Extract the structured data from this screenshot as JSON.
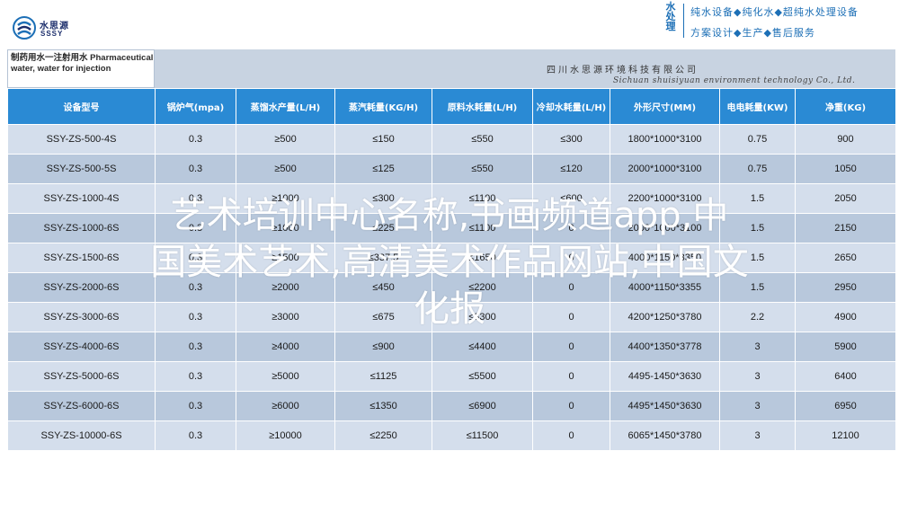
{
  "header": {
    "logo_cn": "水思源",
    "logo_en": "SSSY",
    "vertical_text": "水处理",
    "line1": "纯水设备◆纯化水◆超纯水处理设备",
    "line2": "方案设计◆生产◆售后服务"
  },
  "document": {
    "title": "制药用水一注射用水 Pharmaceutical water, water for injection",
    "company_cn": "四川水思源环境科技有限公司",
    "company_en": "Sichuan shuisiyuan environment technology Co., Ltd."
  },
  "table": {
    "headers": [
      "设备型号",
      "锅炉气(mpa)",
      "蒸馏水产量(L/H)",
      "蒸汽耗量(KG/H)",
      "原料水耗量(L/H)",
      "冷却水耗量(L/H)",
      "外形尺寸(MM)",
      "电电耗量(KW)",
      "净重(KG)"
    ],
    "rows": [
      [
        "SSY-ZS-500-4S",
        "0.3",
        "≥500",
        "≤150",
        "≤550",
        "≤300",
        "1800*1000*3100",
        "0.75",
        "900"
      ],
      [
        "SSY-ZS-500-5S",
        "0.3",
        "≥500",
        "≤125",
        "≤550",
        "≤120",
        "2000*1000*3100",
        "0.75",
        "1050"
      ],
      [
        "SSY-ZS-1000-4S",
        "0.3",
        "≥1000",
        "≤300",
        "≤1100",
        "≤600",
        "2200*1000*3100",
        "1.5",
        "2050"
      ],
      [
        "SSY-ZS-1000-6S",
        "0.3",
        "≥1000",
        "≤225",
        "≤1100",
        "0",
        "2000*1000*3100",
        "1.5",
        "2150"
      ],
      [
        "SSY-ZS-1500-6S",
        "0.3",
        "≥1500",
        "≤337.5",
        "≤1650",
        "0",
        "4000*1150*3350",
        "1.5",
        "2650"
      ],
      [
        "SSY-ZS-2000-6S",
        "0.3",
        "≥2000",
        "≤450",
        "≤2200",
        "0",
        "4000*1150*3355",
        "1.5",
        "2950"
      ],
      [
        "SSY-ZS-3000-6S",
        "0.3",
        "≥3000",
        "≤675",
        "≤3300",
        "0",
        "4200*1250*3780",
        "2.2",
        "4900"
      ],
      [
        "SSY-ZS-4000-6S",
        "0.3",
        "≥4000",
        "≤900",
        "≤4400",
        "0",
        "4400*1350*3778",
        "3",
        "5900"
      ],
      [
        "SSY-ZS-5000-6S",
        "0.3",
        "≥5000",
        "≤1125",
        "≤5500",
        "0",
        "4495-1450*3630",
        "3",
        "6400"
      ],
      [
        "SSY-ZS-6000-6S",
        "0.3",
        "≥6000",
        "≤1350",
        "≤6900",
        "0",
        "4495*1450*3630",
        "3",
        "6950"
      ],
      [
        "SSY-ZS-10000-6S",
        "0.3",
        "≥10000",
        "≤2250",
        "≤11500",
        "0",
        "6065*1450*3780",
        "3",
        "12100"
      ]
    ]
  },
  "overlay": {
    "line1": "艺术培训中心名称,书画频道app,中",
    "line2": "国美术艺术,高清美术作品网站,中国文",
    "line3": "化报"
  },
  "colors": {
    "header_blue": "#2a8ad4",
    "row_light": "#d4deec",
    "row_dark": "#b8c8dc",
    "brand_blue": "#1c6fb6"
  }
}
